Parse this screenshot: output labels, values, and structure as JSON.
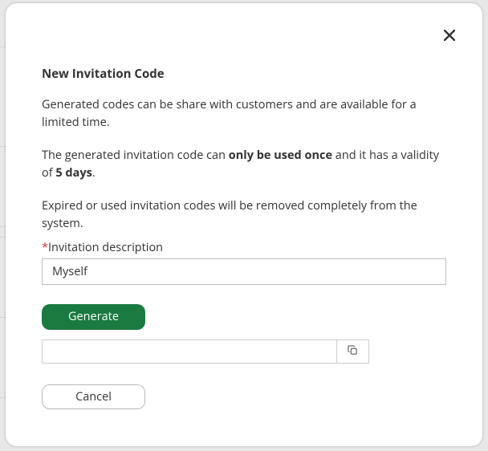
{
  "modal": {
    "title": "New Invitation Code",
    "intro": "Generated codes can be share with customers and are available for a limited time.",
    "usage_pre": "The generated invitation code can ",
    "usage_bold1": "only be used once",
    "usage_mid": " and it has a validity of ",
    "usage_bold2": "5 days",
    "usage_post": ".",
    "expire_note": "Expired or used invitation codes will be removed completely from the system.",
    "description_label": "Invitation description",
    "description_value": "Myself",
    "generate_label": "Generate",
    "code_value": "",
    "cancel_label": "Cancel"
  }
}
